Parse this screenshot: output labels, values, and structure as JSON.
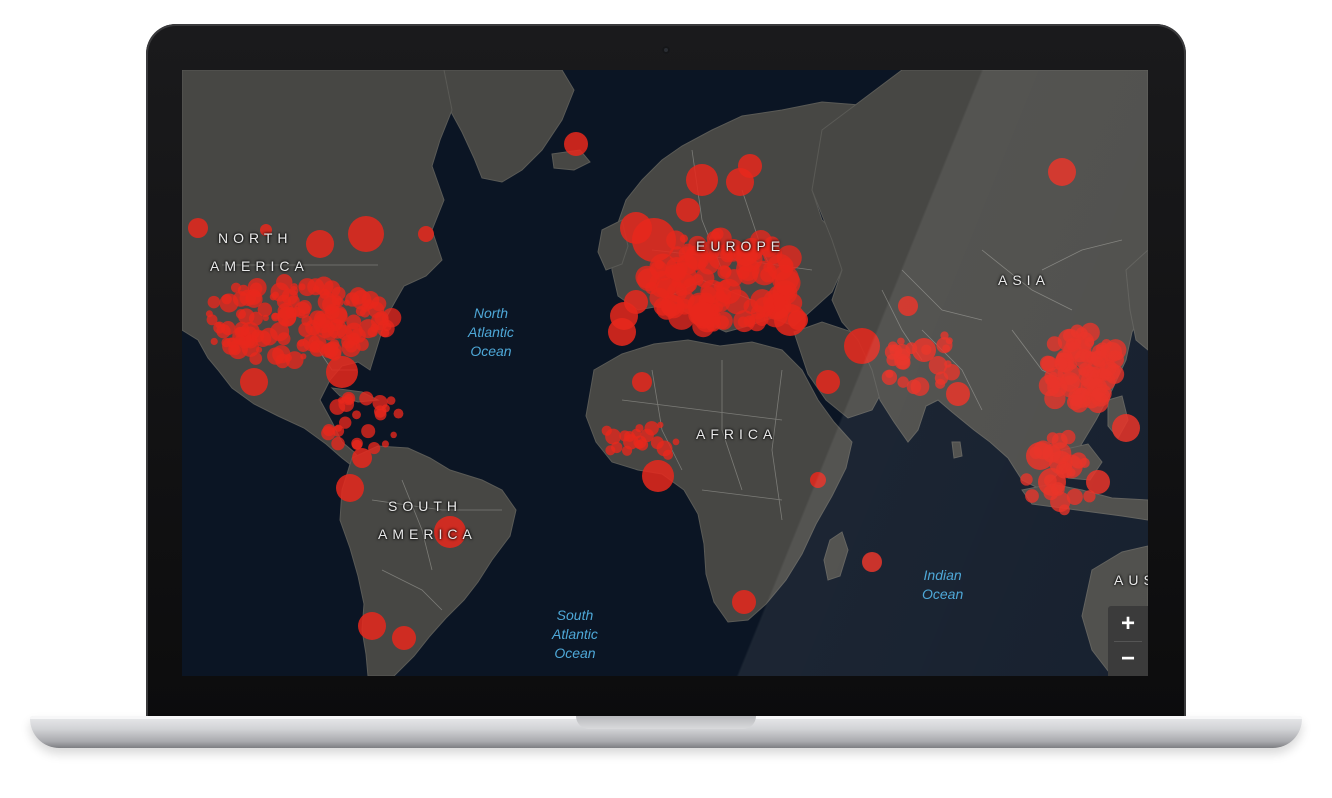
{
  "map": {
    "continent_labels": [
      {
        "id": "north-america",
        "lines": [
          "NORTH",
          "AMERICA"
        ]
      },
      {
        "id": "south-america",
        "lines": [
          "SOUTH",
          "AMERICA"
        ]
      },
      {
        "id": "europe",
        "lines": [
          "EUROPE"
        ]
      },
      {
        "id": "africa",
        "lines": [
          "AFRICA"
        ]
      },
      {
        "id": "asia",
        "lines": [
          "ASIA"
        ]
      },
      {
        "id": "australia",
        "lines": [
          "AUS"
        ]
      }
    ],
    "ocean_labels": [
      {
        "id": "north-atlantic",
        "text": "North\nAtlantic\nOcean"
      },
      {
        "id": "south-atlantic",
        "text": "South\nAtlantic\nOcean"
      },
      {
        "id": "indian",
        "text": "Indian\nOcean"
      }
    ],
    "zoom_in_label": "+",
    "zoom_out_label": "−"
  },
  "colors": {
    "ocean": "#0b1524",
    "land": "#474744",
    "borders": "#8d8d88",
    "marker": "#e8281c"
  }
}
